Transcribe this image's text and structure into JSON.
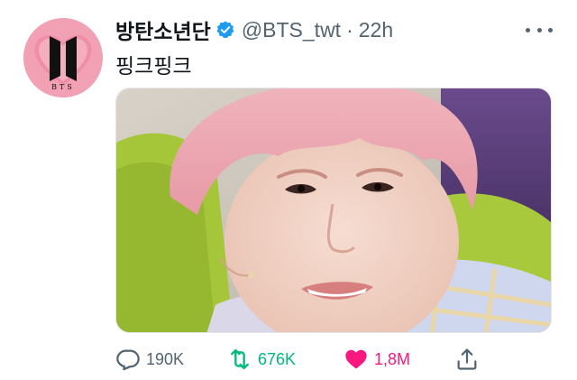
{
  "author": {
    "display_name": "방탄소년단",
    "handle": "@BTS_twt",
    "separator": "·",
    "timestamp": "22h",
    "avatar_label": "BTS",
    "verified": true
  },
  "tweet": {
    "text": "핑크핑크"
  },
  "actions": {
    "reply_count": "190K",
    "retweet_count": "676K",
    "like_count": "1,8M"
  },
  "colors": {
    "verified_blue": "#1d9bf0",
    "retweet_green": "#00ba7c",
    "like_pink": "#f91880",
    "muted_gray": "#536471",
    "avatar_pink": "#f2a0b3"
  },
  "icons": [
    "verified-badge-icon",
    "more-icon",
    "reply-icon",
    "retweet-icon",
    "heart-icon",
    "share-icon"
  ]
}
